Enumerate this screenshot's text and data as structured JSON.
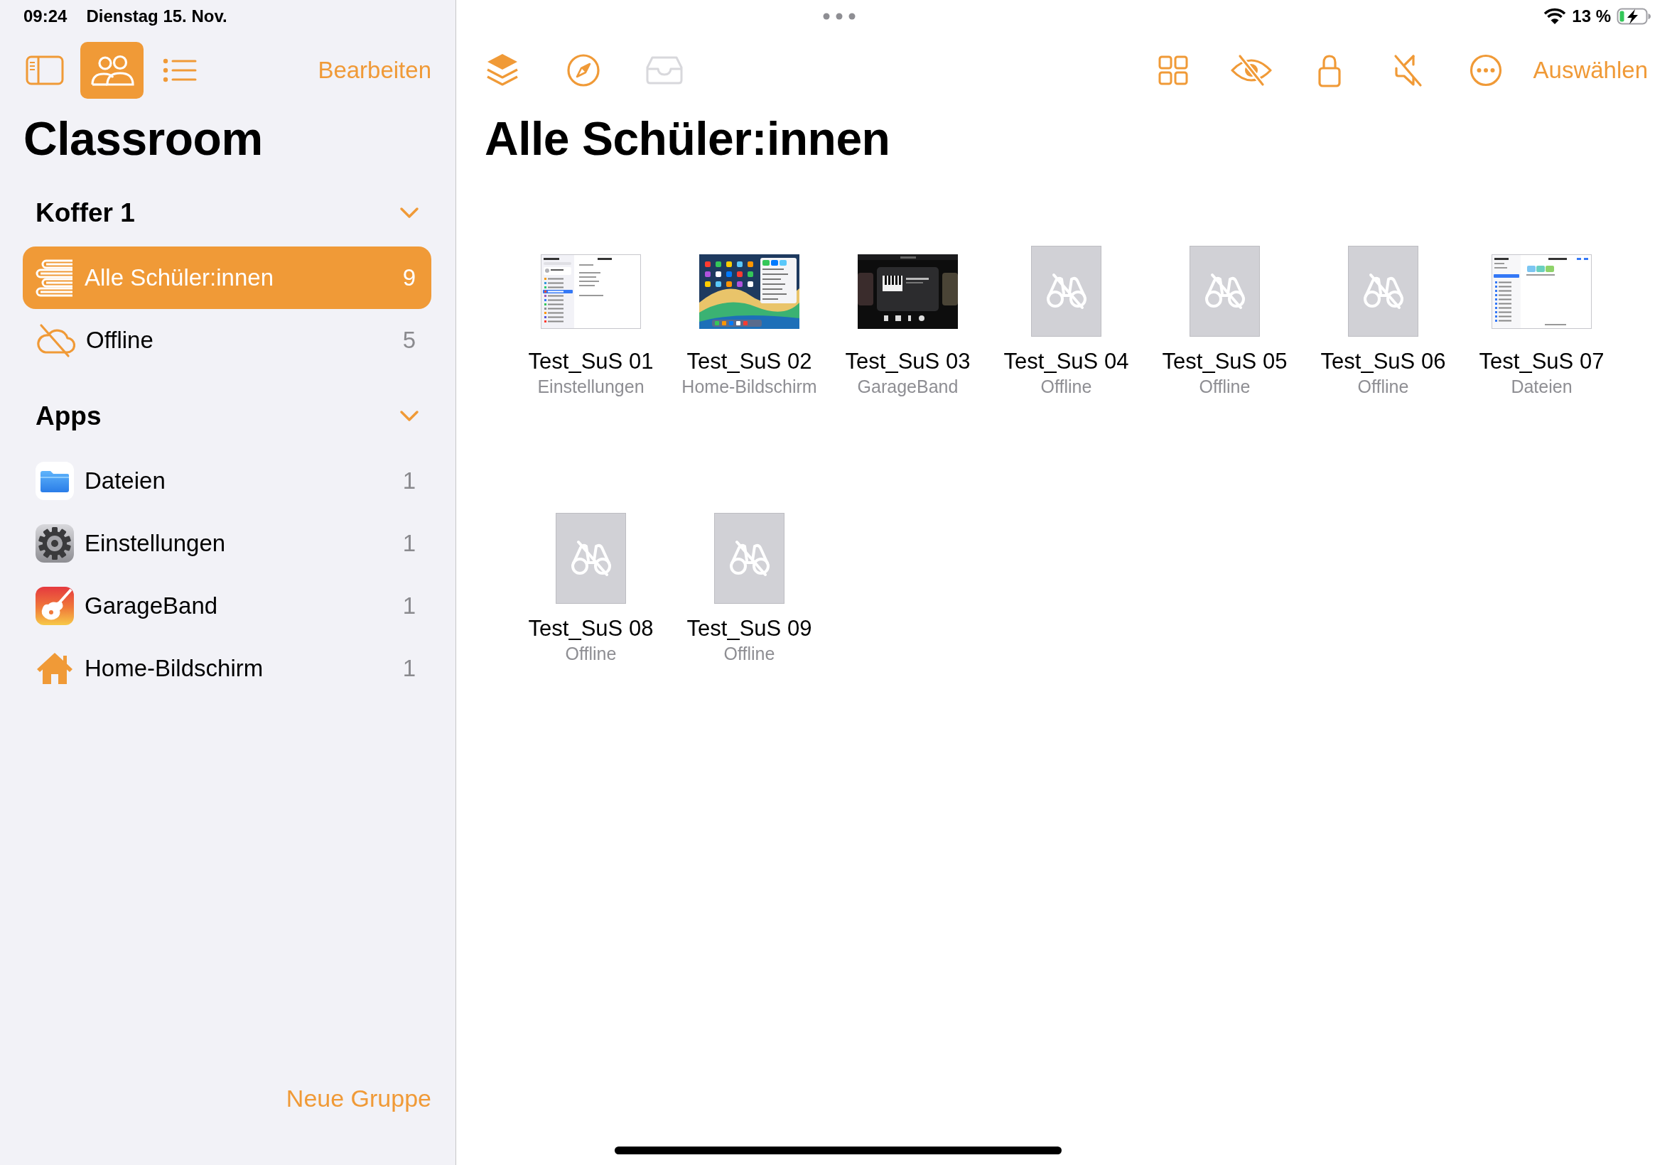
{
  "status_bar": {
    "time": "09:24",
    "date": "Dienstag 15. Nov.",
    "battery": "13 %"
  },
  "sidebar": {
    "view_modes": [
      {
        "kind": "sidebar",
        "selected": false
      },
      {
        "kind": "students",
        "selected": true
      },
      {
        "kind": "list",
        "selected": false
      }
    ],
    "edit_button": "Bearbeiten",
    "title": "Classroom",
    "sections": [
      {
        "title": "Koffer 1",
        "expanded": true,
        "items": [
          {
            "kind": "all",
            "label": "Alle Schüler:innen",
            "count": "9",
            "selected": true
          },
          {
            "kind": "offline",
            "label": "Offline",
            "count": "5",
            "selected": false
          }
        ]
      },
      {
        "title": "Apps",
        "expanded": true,
        "items": [
          {
            "kind": "files",
            "label": "Dateien",
            "count": "1",
            "selected": false
          },
          {
            "kind": "settings",
            "label": "Einstellungen",
            "count": "1",
            "selected": false
          },
          {
            "kind": "garageband",
            "label": "GarageBand",
            "count": "1",
            "selected": false
          },
          {
            "kind": "home",
            "label": "Home-Bildschirm",
            "count": "1",
            "selected": false
          }
        ]
      }
    ],
    "new_group_button": "Neue Gruppe"
  },
  "toolbar": {
    "left_tools": [
      {
        "kind": "layers",
        "disabled": false
      },
      {
        "kind": "compass",
        "disabled": false
      },
      {
        "kind": "tray",
        "disabled": true
      }
    ],
    "right_tools": [
      {
        "kind": "grid"
      },
      {
        "kind": "hide"
      },
      {
        "kind": "lock"
      },
      {
        "kind": "mute"
      },
      {
        "kind": "more"
      }
    ],
    "select_button": "Auswählen"
  },
  "main": {
    "title": "Alle Schüler:innen",
    "students": [
      {
        "name": "Test_SuS 01",
        "status": "Einstellungen",
        "kind": "settings"
      },
      {
        "name": "Test_SuS 02",
        "status": "Home-Bildschirm",
        "kind": "homescreen"
      },
      {
        "name": "Test_SuS 03",
        "status": "GarageBand",
        "kind": "garageband"
      },
      {
        "name": "Test_SuS 04",
        "status": "Offline",
        "kind": "offline"
      },
      {
        "name": "Test_SuS 05",
        "status": "Offline",
        "kind": "offline"
      },
      {
        "name": "Test_SuS 06",
        "status": "Offline",
        "kind": "offline"
      },
      {
        "name": "Test_SuS 07",
        "status": "Dateien",
        "kind": "files"
      },
      {
        "name": "Test_SuS 08",
        "status": "Offline",
        "kind": "offline"
      },
      {
        "name": "Test_SuS 09",
        "status": "Offline",
        "kind": "offline"
      }
    ]
  }
}
